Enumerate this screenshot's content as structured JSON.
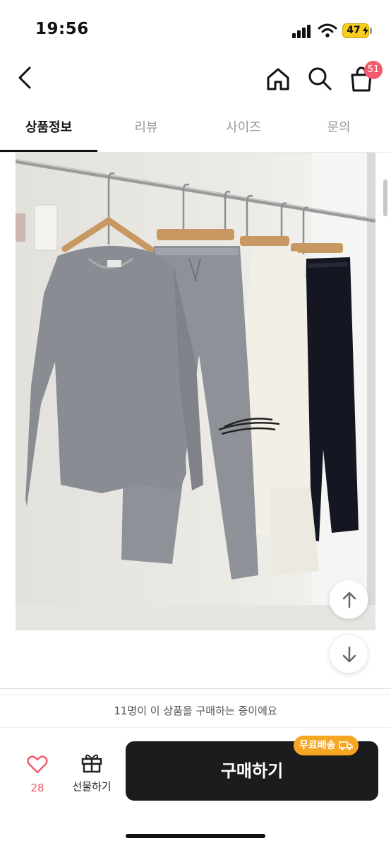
{
  "status_bar": {
    "time": "19:56",
    "battery": "47",
    "icons": [
      "signal-icon",
      "wifi-icon",
      "battery-icon"
    ]
  },
  "header": {
    "icons": [
      "back-arrow-icon",
      "home-icon",
      "search-icon",
      "cart-icon"
    ],
    "cart_badge": "51"
  },
  "tabs": [
    {
      "label": "상품정보",
      "active": true
    },
    {
      "label": "리뷰",
      "active": false
    },
    {
      "label": "사이즈",
      "active": false
    },
    {
      "label": "문의",
      "active": false
    }
  ],
  "product_image": {
    "icons": [
      "scroll-up-icon",
      "scroll-down-icon"
    ]
  },
  "notice": "11명이 이 상품을 구매하는 중이에요",
  "bottom_bar": {
    "like_count": "28",
    "gift_label": "선물하기",
    "buy_label": "구매하기",
    "free_shipping_badge": "무료배송",
    "icons": [
      "heart-icon",
      "gift-icon",
      "truck-icon"
    ]
  },
  "colors": {
    "accent_pink": "#f25c6e",
    "buy_button": "#1c1c1e",
    "badge_orange": "#f5a623",
    "battery_yellow": "#f6cc1e"
  }
}
